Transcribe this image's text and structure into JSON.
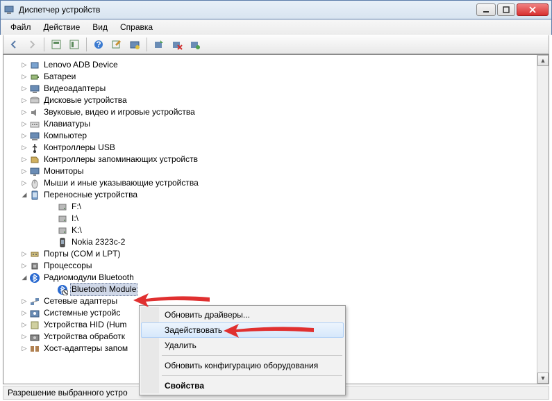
{
  "window": {
    "title": "Диспетчер устройств"
  },
  "menu": {
    "file": "Файл",
    "action": "Действие",
    "view": "Вид",
    "help": "Справка"
  },
  "tree": {
    "items": [
      {
        "label": "Lenovo ADB Device",
        "icon": "device-icon"
      },
      {
        "label": "Батареи",
        "icon": "battery-icon"
      },
      {
        "label": "Видеоадаптеры",
        "icon": "display-adapter-icon"
      },
      {
        "label": "Дисковые устройства",
        "icon": "disk-icon"
      },
      {
        "label": "Звуковые, видео и игровые устройства",
        "icon": "sound-icon"
      },
      {
        "label": "Клавиатуры",
        "icon": "keyboard-icon"
      },
      {
        "label": "Компьютер",
        "icon": "computer-icon"
      },
      {
        "label": "Контроллеры USB",
        "icon": "usb-icon"
      },
      {
        "label": "Контроллеры запоминающих устройств",
        "icon": "storage-icon"
      },
      {
        "label": "Мониторы",
        "icon": "monitor-icon"
      },
      {
        "label": "Мыши и иные указывающие устройства",
        "icon": "mouse-icon"
      }
    ],
    "portable": {
      "label": "Переносные устройства",
      "children": [
        {
          "label": "F:\\",
          "icon": "drive-icon"
        },
        {
          "label": "I:\\",
          "icon": "drive-icon"
        },
        {
          "label": "K:\\",
          "icon": "drive-icon"
        },
        {
          "label": "Nokia 2323c-2",
          "icon": "phone-icon"
        }
      ]
    },
    "after": [
      {
        "label": "Порты (COM и LPT)",
        "icon": "port-icon"
      },
      {
        "label": "Процессоры",
        "icon": "cpu-icon"
      }
    ],
    "bluetooth": {
      "label": "Радиомодули Bluetooth",
      "child": {
        "label": "Bluetooth Module",
        "icon": "bluetooth-icon",
        "selected": true
      }
    },
    "tail": [
      {
        "label": "Сетевые адаптеры",
        "icon": "network-icon"
      },
      {
        "label": "Системные устройс",
        "icon": "system-icon"
      },
      {
        "label": "Устройства HID (Hum",
        "icon": "hid-icon"
      },
      {
        "label": "Устройства обработк",
        "icon": "imaging-icon"
      },
      {
        "label": "Хост-адаптеры запом",
        "icon": "host-icon"
      }
    ]
  },
  "context_menu": {
    "update_drivers": "Обновить драйверы...",
    "enable": "Задействовать",
    "delete": "Удалить",
    "refresh_config": "Обновить конфигурацию оборудования",
    "properties": "Свойства"
  },
  "statusbar": {
    "text": "Разрешение выбранного устро"
  }
}
